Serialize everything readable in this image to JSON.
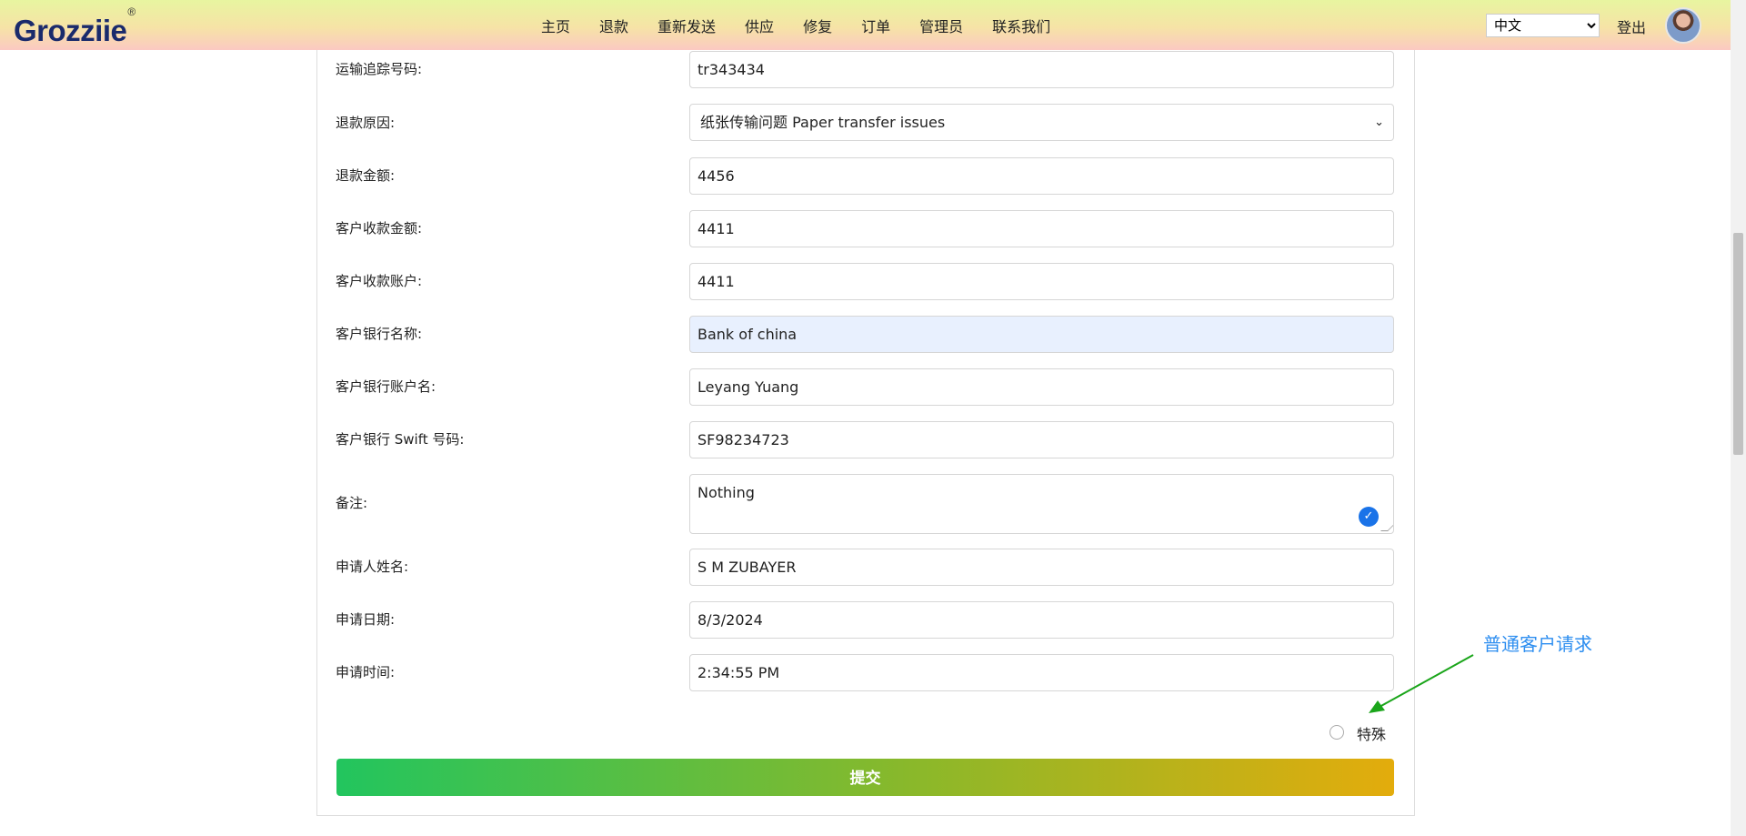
{
  "header": {
    "logo": "Grozziie",
    "logo_mark": "®",
    "nav": [
      "主页",
      "退款",
      "重新发送",
      "供应",
      "修复",
      "订单",
      "管理员",
      "联系我们"
    ],
    "language": "中文",
    "logout": "登出",
    "avatar_icon": "user-avatar"
  },
  "form": {
    "fields": [
      {
        "label": "运输追踪号码:",
        "value": "tr343434"
      },
      {
        "label": "退款原因:",
        "value": "纸张传输问题 Paper transfer issues",
        "type": "select"
      },
      {
        "label": "退款金额:",
        "value": "4456"
      },
      {
        "label": "客户收款金额:",
        "value": "4411"
      },
      {
        "label": "客户收款账户:",
        "value": "4411"
      },
      {
        "label": "客户银行名称:",
        "value": "Bank of china"
      },
      {
        "label": "客户银行账户名:",
        "value": "Leyang Yuang"
      },
      {
        "label": "客户银行 Swift 号码:",
        "value": "SF98234723"
      },
      {
        "label": "备注:",
        "value": "Nothing",
        "type": "textarea"
      },
      {
        "label": "申请人姓名:",
        "value": "S M ZUBAYER"
      },
      {
        "label": "申请日期:",
        "value": "8/3/2024"
      },
      {
        "label": "申请时间:",
        "value": "2:34:55 PM"
      }
    ],
    "special_label": "特殊",
    "submit_label": "提交"
  },
  "annotation": {
    "text": "普通客户请求",
    "color": "#2d8ef0",
    "arrow_color": "#1aa51a"
  }
}
